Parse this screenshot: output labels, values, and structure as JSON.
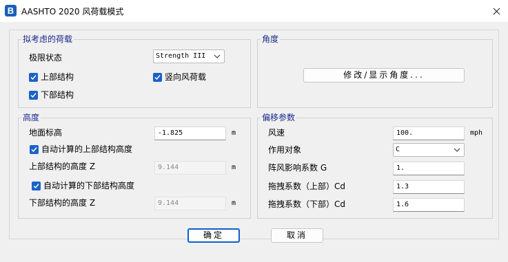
{
  "window": {
    "title": "AASHTO 2020 风荷载模式",
    "icon_letter": "B"
  },
  "loads": {
    "title": "拟考虑的荷载",
    "limit_state_label": "极限状态",
    "limit_state_value": "Strength III",
    "superstructure_label": "上部结构",
    "substructure_label": "下部结构",
    "vertical_wind_label": "竖向风荷载"
  },
  "angle": {
    "title": "角度",
    "modify_button": "修改/显示角度..."
  },
  "height": {
    "title": "高度",
    "ground_elevation_label": "地面标高",
    "ground_elevation_value": "-1.825",
    "ground_elevation_unit": "m",
    "auto_super_label": "自动计算的上部结构高度",
    "super_height_label": "上部结构的高度 Z",
    "super_height_value": "9.144",
    "super_height_unit": "m",
    "auto_sub_label": "自动计算的下部结构高度",
    "sub_height_label": "下部结构的高度 Z",
    "sub_height_value": "9.144",
    "sub_height_unit": "m"
  },
  "offset": {
    "title": "偏移参数",
    "wind_speed_label": "风速",
    "wind_speed_value": "100.",
    "wind_speed_unit": "mph",
    "target_label": "作用对象",
    "target_value": "C",
    "gust_label": "阵风影响系数 G",
    "gust_value": "1.",
    "drag_upper_label": "拖拽系数（上部）Cd",
    "drag_upper_value": "1.3",
    "drag_lower_label": "拖拽系数（下部）Cd",
    "drag_lower_value": "1.6"
  },
  "buttons": {
    "ok": "确定",
    "cancel": "取消"
  },
  "colors": {
    "accent": "#1a62c9",
    "group_title": "#1b2a8c"
  }
}
